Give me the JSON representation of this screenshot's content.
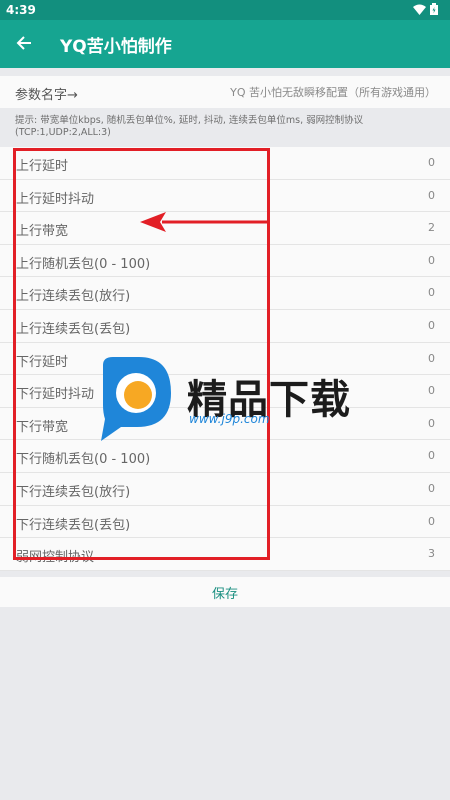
{
  "status_bar": {
    "time": "4:39",
    "icons": [
      "wifi-icon",
      "battery-icon"
    ]
  },
  "app_bar": {
    "title": "YQ苦小怕制作",
    "back_icon": "arrow-left-icon"
  },
  "param": {
    "label": "参数名字→",
    "value": "YQ 苦小怕无敌瞬移配置（所有游戏通用）"
  },
  "hint": "提示: 带宽单位kbps, 随机丢包单位%, 延时, 抖动, 连续丢包单位ms, 弱网控制协议(TCP:1,UDP:2,ALL:3)",
  "rows": [
    {
      "label": "上行延时",
      "value": "0"
    },
    {
      "label": "上行延时抖动",
      "value": "0"
    },
    {
      "label": "上行带宽",
      "value": "2"
    },
    {
      "label": "上行随机丢包(0 - 100)",
      "value": "0"
    },
    {
      "label": "上行连续丢包(放行)",
      "value": "0"
    },
    {
      "label": "上行连续丢包(丢包)",
      "value": "0"
    },
    {
      "label": "下行延时",
      "value": "0"
    },
    {
      "label": "下行延时抖动",
      "value": "0"
    },
    {
      "label": "下行带宽",
      "value": "0"
    },
    {
      "label": "下行随机丢包(0 - 100)",
      "value": "0"
    },
    {
      "label": "下行连续丢包(放行)",
      "value": "0"
    },
    {
      "label": "下行连续丢包(丢包)",
      "value": "0"
    },
    {
      "label": "弱网控制协议",
      "value": "3"
    }
  ],
  "save_label": "保存",
  "watermark": {
    "name": "精品下载",
    "url": "www.j9p.com"
  },
  "colors": {
    "app_bar": "#16a591",
    "status_bar": "#128f7e",
    "annotation": "#e21f26",
    "save_text": "#1a8f80"
  }
}
